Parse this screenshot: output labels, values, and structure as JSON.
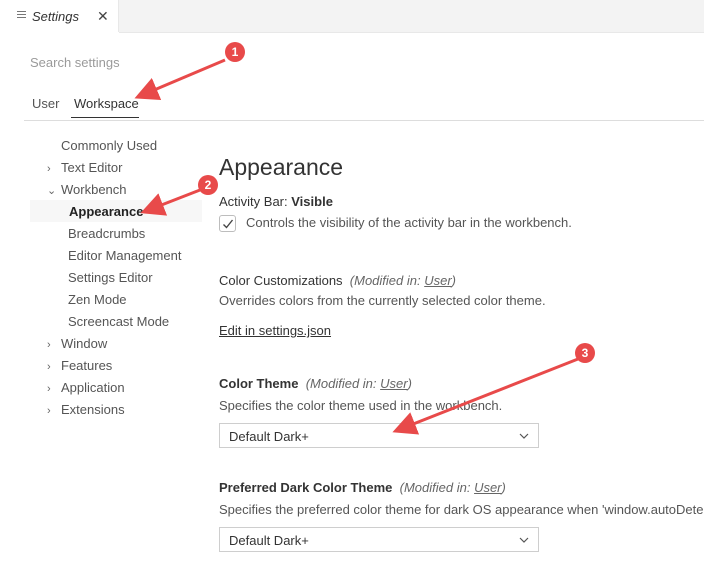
{
  "tab": {
    "title": "Settings",
    "close": "✕",
    "icon": "list-icon"
  },
  "search": {
    "placeholder": "Search settings"
  },
  "scopes": {
    "user": "User",
    "workspace": "Workspace"
  },
  "toc": {
    "items": [
      {
        "label": "Commonly Used",
        "chevron": ""
      },
      {
        "label": "Text Editor",
        "chevron": "›"
      },
      {
        "label": "Workbench",
        "chevron": "⌄"
      },
      {
        "label": "Appearance",
        "chevron": ""
      },
      {
        "label": "Breadcrumbs",
        "chevron": ""
      },
      {
        "label": "Editor Management",
        "chevron": ""
      },
      {
        "label": "Settings Editor",
        "chevron": ""
      },
      {
        "label": "Zen Mode",
        "chevron": ""
      },
      {
        "label": "Screencast Mode",
        "chevron": ""
      },
      {
        "label": "Window",
        "chevron": "›"
      },
      {
        "label": "Features",
        "chevron": "›"
      },
      {
        "label": "Application",
        "chevron": "›"
      },
      {
        "label": "Extensions",
        "chevron": "›"
      }
    ]
  },
  "main": {
    "heading": "Appearance",
    "activity_bar": {
      "title_prefix": "Activity Bar: ",
      "title_value": "Visible",
      "description": "Controls the visibility of the activity bar in the workbench.",
      "checked": true
    },
    "color_customizations": {
      "title": "Color Customizations",
      "modified_prefix": "(Modified in: ",
      "modified_link": "User",
      "modified_suffix": ")",
      "description": "Overrides colors from the currently selected color theme.",
      "link": "Edit in settings.json"
    },
    "color_theme": {
      "title": "Color Theme",
      "modified_prefix": "(Modified in: ",
      "modified_link": "User",
      "modified_suffix": ")",
      "description": "Specifies the color theme used in the workbench.",
      "value": "Default Dark+"
    },
    "preferred_dark": {
      "title": "Preferred Dark Color Theme",
      "modified_prefix": "(Modified in: ",
      "modified_link": "User",
      "modified_suffix": ")",
      "description": "Specifies the preferred color theme for dark OS appearance when 'window.autoDetec",
      "value": "Default Dark+"
    }
  },
  "annotations": {
    "badges": [
      "1",
      "2",
      "3"
    ],
    "color": "#e84a4a"
  }
}
